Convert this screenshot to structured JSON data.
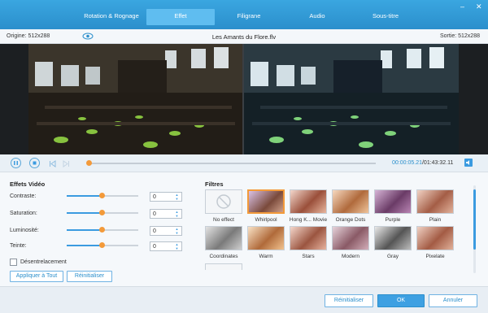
{
  "tabs": [
    {
      "label": "Rotation & Rognage",
      "active": false
    },
    {
      "label": "Effet",
      "active": true
    },
    {
      "label": "Filigrane",
      "active": false
    },
    {
      "label": "Audio",
      "active": false
    },
    {
      "label": "Sous-titre",
      "active": false
    }
  ],
  "window_controls": {
    "minimize": "–",
    "close": "✕"
  },
  "info": {
    "origin": "Origine: 512x288",
    "filename": "Les Amants du Flore.flv",
    "output": "Sortie: 512x288"
  },
  "playback": {
    "current_time": "00:00:05.21",
    "total_time": "/01:43:32.11",
    "progress": 0.0
  },
  "effects": {
    "title": "Effets Vidéo",
    "controls": [
      {
        "label": "Contraste:",
        "value": "0",
        "level": 0.5
      },
      {
        "label": "Saturation:",
        "value": "0",
        "level": 0.5
      },
      {
        "label": "Luminosité:",
        "value": "0",
        "level": 0.5
      },
      {
        "label": "Teinte:",
        "value": "0",
        "level": 0.5
      }
    ],
    "deinterlace": {
      "label": "Désentrelacement",
      "checked": false
    },
    "apply_all": "Appliquer à Tout",
    "reset": "Réinitialiser"
  },
  "filters": {
    "title": "Filtres",
    "items": [
      {
        "label": "No effect",
        "selected": false,
        "tone": "none"
      },
      {
        "label": "Whirlpool",
        "selected": true,
        "tone": "whirl"
      },
      {
        "label": "Hong K... Movie",
        "selected": false,
        "tone": "hk"
      },
      {
        "label": "Orange Dots",
        "selected": false,
        "tone": "orange"
      },
      {
        "label": "Purple",
        "selected": false,
        "tone": "purple"
      },
      {
        "label": "Plain",
        "selected": false,
        "tone": "plain"
      },
      {
        "label": "Coordinates",
        "selected": false,
        "tone": "gray"
      },
      {
        "label": "Warm",
        "selected": false,
        "tone": "warm"
      },
      {
        "label": "Stars",
        "selected": false,
        "tone": "stars"
      },
      {
        "label": "Modern",
        "selected": false,
        "tone": "modern"
      },
      {
        "label": "Gray",
        "selected": false,
        "tone": "bw"
      },
      {
        "label": "Pixelate",
        "selected": false,
        "tone": "pixel"
      }
    ]
  },
  "footer": {
    "reset": "Réinitialiser",
    "ok": "OK",
    "cancel": "Annuler"
  },
  "colors": {
    "accent": "#3ea0e2",
    "highlight": "#f39a3a",
    "header": "#2b8fcc"
  }
}
